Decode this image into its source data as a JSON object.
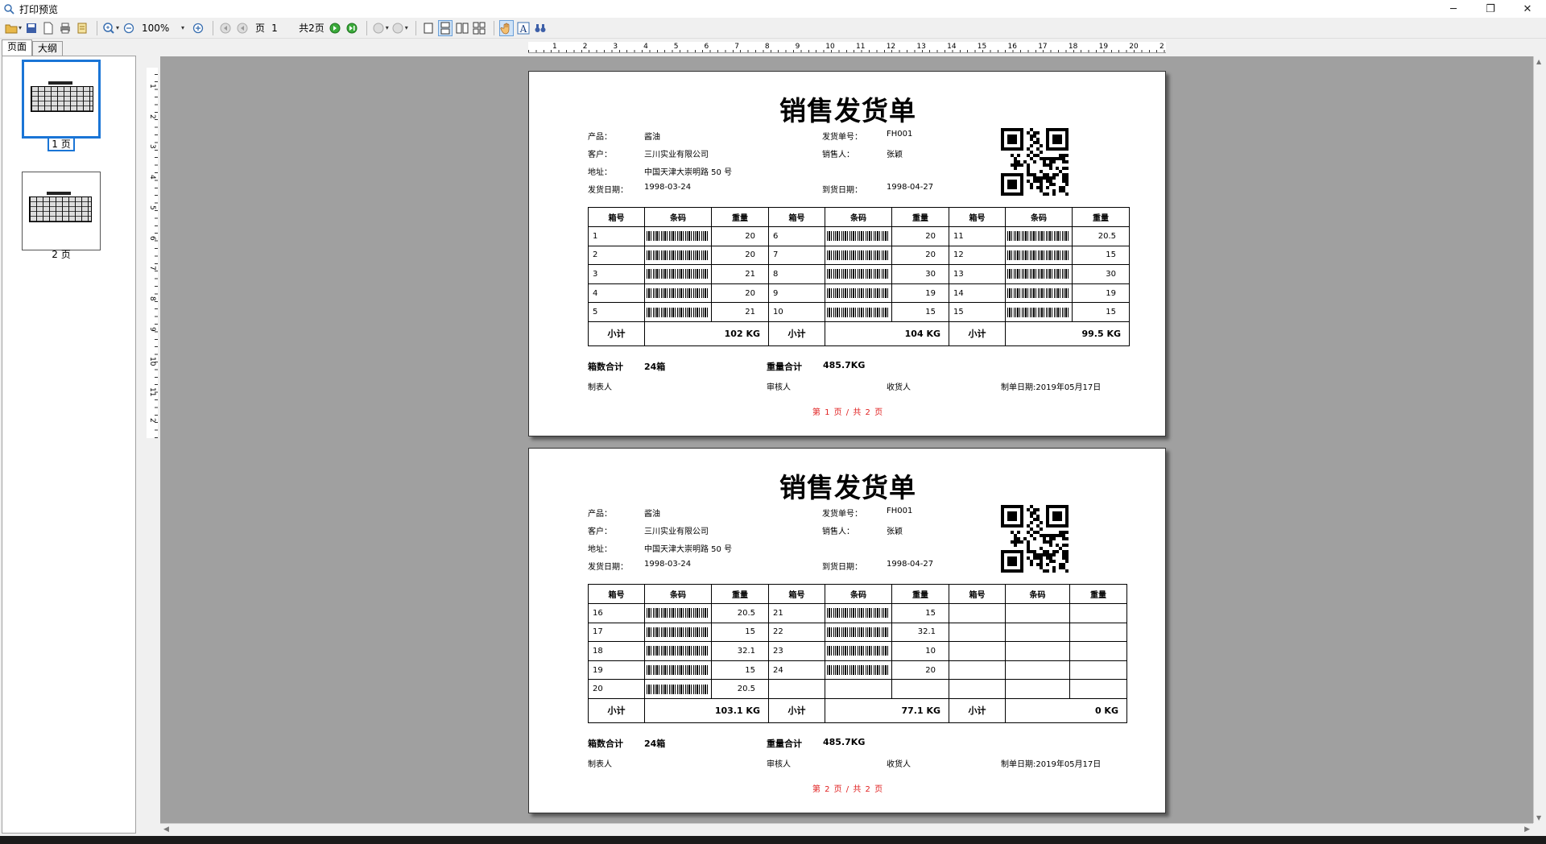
{
  "window": {
    "title": "打印预览",
    "minimize": "─",
    "maximize": "❐",
    "close": "✕"
  },
  "toolbar": {
    "zoom": "100%",
    "page_label": "页",
    "page_current": "1",
    "page_total": "共2页"
  },
  "tabs": [
    "页面",
    "大纲"
  ],
  "thumbnails": [
    {
      "label": "1 页"
    },
    {
      "label": "2 页"
    }
  ],
  "ruler": {
    "h_ticks": [
      "1",
      "2",
      "3",
      "4",
      "5",
      "6",
      "7",
      "8",
      "9",
      "10",
      "11",
      "12",
      "13",
      "14",
      "15",
      "16",
      "17",
      "18",
      "19",
      "20",
      "2"
    ],
    "v_ticks": [
      "1",
      "2",
      "3",
      "4",
      "5",
      "6",
      "7",
      "8",
      "9",
      "10",
      "11",
      "2"
    ]
  },
  "report": {
    "title": "销售发货单",
    "product_label": "产品：",
    "product": "酱油",
    "customer_label": "客户：",
    "customer": "三川实业有限公司",
    "address_label": "地址：",
    "address": "中国天津大崇明路 50 号",
    "ship_date_label": "发货日期：",
    "ship_date": "1998-03-24",
    "ship_no_label": "发货单号：",
    "ship_no": "FH001",
    "seller_label": "销售人：",
    "seller": "张颖",
    "arrive_date_label": "到货日期：",
    "arrive_date": "1998-04-27",
    "headers": [
      "箱号",
      "条码",
      "重量",
      "箱号",
      "条码",
      "重量",
      "箱号",
      "条码",
      "重量"
    ],
    "subtotal_label": "小计",
    "total_boxes_label": "箱数合计",
    "total_boxes": "24箱",
    "total_weight_label": "重量合计",
    "total_weight": "485.7KG",
    "maker": "制表人",
    "checker": "审核人",
    "receiver": "收货人",
    "make_date": "制单日期:2019年05月17日"
  },
  "pages": [
    {
      "rows": [
        [
          "1",
          "20",
          "6",
          "20",
          "11",
          "20.5"
        ],
        [
          "2",
          "20",
          "7",
          "20",
          "12",
          "15"
        ],
        [
          "3",
          "21",
          "8",
          "30",
          "13",
          "30"
        ],
        [
          "4",
          "20",
          "9",
          "19",
          "14",
          "19"
        ],
        [
          "5",
          "21",
          "10",
          "15",
          "15",
          "15"
        ]
      ],
      "subtotals": [
        "102 KG",
        "104 KG",
        "99.5 KG"
      ],
      "pageno": "第 1 页 / 共 2 页"
    },
    {
      "rows": [
        [
          "16",
          "20.5",
          "21",
          "15",
          "",
          ""
        ],
        [
          "17",
          "15",
          "22",
          "32.1",
          "",
          ""
        ],
        [
          "18",
          "32.1",
          "23",
          "10",
          "",
          ""
        ],
        [
          "19",
          "15",
          "24",
          "20",
          "",
          ""
        ],
        [
          "20",
          "20.5",
          "",
          "",
          "",
          ""
        ]
      ],
      "subtotals": [
        "103.1 KG",
        "77.1 KG",
        "0 KG"
      ],
      "pageno": "第 2 页 / 共 2 页"
    }
  ]
}
